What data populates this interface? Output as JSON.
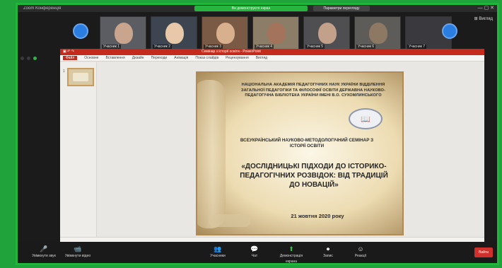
{
  "titlebar": {
    "app_title": "Zoom Конференція",
    "share_status": "Ви демонструєте екран",
    "view_options": "Параметри перегляду",
    "window_controls": "— ▢ ✕"
  },
  "participants": [
    {
      "name": "Учасник 1"
    },
    {
      "name": "Учасник 2"
    },
    {
      "name": "Учасник 3"
    },
    {
      "name": "Учасник 4"
    },
    {
      "name": "Учасник 5"
    },
    {
      "name": "Учасник 6"
    },
    {
      "name": "Учасник 7"
    }
  ],
  "right_tools": "⊞ Вигляд",
  "ppt": {
    "quick_access": "▣ ↶ ↷",
    "doc_title": "Семінар з історії освіти - PowerPoint",
    "menu": [
      "Файл",
      "Основне",
      "Вставлення",
      "Дизайн",
      "Переходи",
      "Анімація",
      "Показ слайдів",
      "Рецензування",
      "Вигляд"
    ],
    "slide_number": "1"
  },
  "slide": {
    "org_text": "НАЦІОНАЛЬНА АКАДЕМІЯ ПЕДАГОГІЧНИХ НАУК УКРАЇНИ ВІДДІЛЕННЯ ЗАГАЛЬНОЇ ПЕДАГОГІКИ ТА ФІЛОСОФІЇ ОСВІТИ ДЕРЖАВНА НАУКОВО-ПЕДАГОГІЧНА БІБЛІОТЕКА УКРАЇНИ ІМЕНІ В.О. СУХОМЛИНСЬКОГО",
    "seminar_text": "ВСЕУКРАЇНСЬКИЙ НАУКОВО-МЕТОДОЛОГІЧНИЙ СЕМІНАР З ІСТОРІЇ ОСВІТИ",
    "main_title": "«ДОСЛІДНИЦЬКІ ПІДХОДИ ДО ІСТОРИКО-ПЕДАГОГІЧНИХ РОЗВІДОК: ВІД ТРАДИЦІЙ ДО НОВАЦІЙ»",
    "date": "21 жовтня 2020 року",
    "emblem_icon": "library-emblem-icon"
  },
  "toolbar": {
    "buttons": [
      {
        "icon": "🎤",
        "label": "Увімкнути звук"
      },
      {
        "icon": "📹",
        "label": "Увімкнути відео"
      },
      {
        "icon": "👥",
        "label": "Учасники"
      },
      {
        "icon": "💬",
        "label": "Чат"
      },
      {
        "icon": "⬆",
        "label": "Демонстрація екрана"
      },
      {
        "icon": "⏺",
        "label": "Запис"
      },
      {
        "icon": "☺",
        "label": "Реакції"
      }
    ],
    "end_label": "Вийти"
  },
  "colors": {
    "accent_green": "#20b53b",
    "ppt_red": "#c42b1c",
    "zoom_blue": "#2a7de1",
    "end_red": "#d0302c"
  }
}
